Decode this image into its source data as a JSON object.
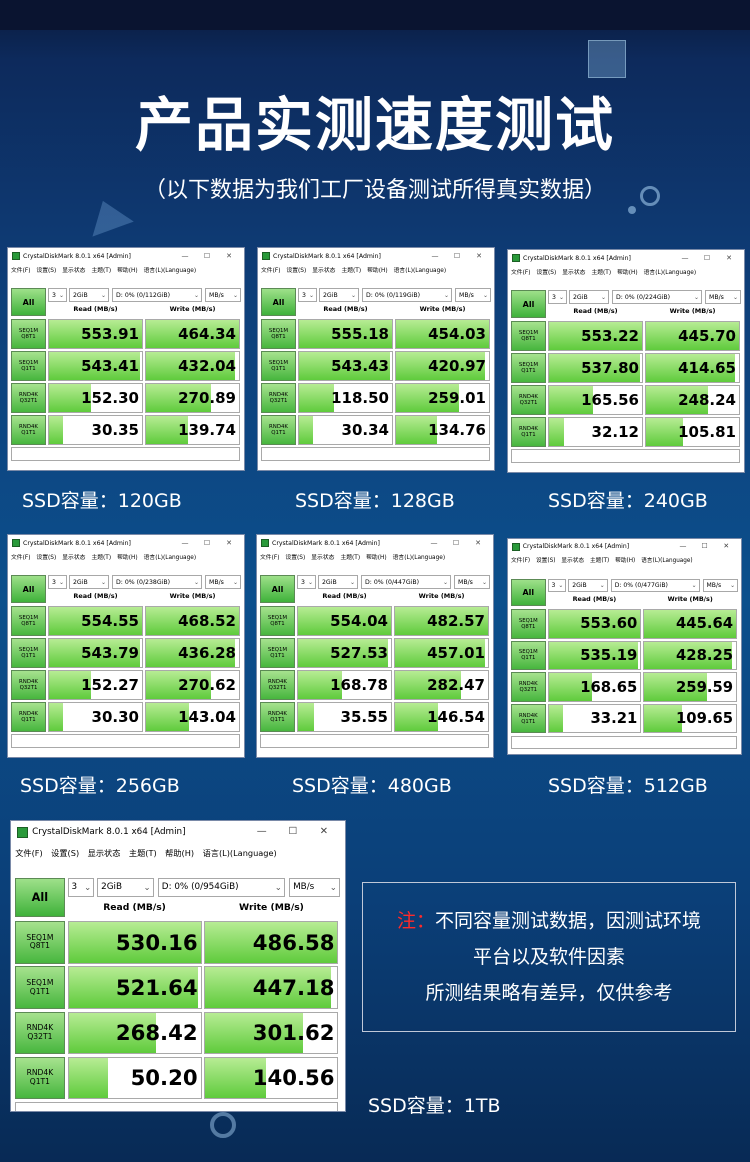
{
  "page": {
    "title": "产品实测速度测试",
    "subtitle": "（以下数据为我们工厂设备测试所得真实数据）",
    "note_prefix": "注：",
    "note_line1": "不同容量测试数据，因测试环境",
    "note_line2": "平台以及软件因素",
    "note_line3": "所测结果略有差异，仅供参考"
  },
  "ui": {
    "window_title": "CrystalDiskMark 8.0.1 x64 [Admin]",
    "minimize": "—",
    "maximize": "☐",
    "close": "✕",
    "menu": [
      "文件(F)",
      "设置(S)",
      "显示状态",
      "主题(T)",
      "帮助(H)",
      "语言(L)(Language)"
    ],
    "all_button": "All",
    "count": "3",
    "size": "2GiB",
    "unit": "MB/s",
    "read_header": "Read (MB/s)",
    "write_header": "Write (MB/s)",
    "tests": [
      {
        "line1": "SEQ1M",
        "line2": "Q8T1"
      },
      {
        "line1": "SEQ1M",
        "line2": "Q1T1"
      },
      {
        "line1": "RND4K",
        "line2": "Q32T1"
      },
      {
        "line1": "RND4K",
        "line2": "Q1T1"
      }
    ]
  },
  "panels": [
    {
      "drive": "D: 0% (0/112GiB)",
      "caption": "SSD容量：120GB",
      "read": [
        "553.91",
        "543.41",
        "152.30",
        "30.35"
      ],
      "write": [
        "464.34",
        "432.04",
        "270.89",
        "139.74"
      ],
      "read_fill": [
        1.0,
        0.98,
        0.45,
        0.15
      ],
      "write_fill": [
        1.0,
        0.96,
        0.7,
        0.45
      ]
    },
    {
      "drive": "D: 0% (0/119GiB)",
      "caption": "SSD容量：128GB",
      "read": [
        "555.18",
        "543.43",
        "118.50",
        "30.34"
      ],
      "write": [
        "454.03",
        "420.97",
        "259.01",
        "134.76"
      ],
      "read_fill": [
        1.0,
        0.98,
        0.38,
        0.15
      ],
      "write_fill": [
        1.0,
        0.96,
        0.68,
        0.44
      ]
    },
    {
      "drive": "D: 0% (0/224GiB)",
      "caption": "SSD容量：240GB",
      "read": [
        "553.22",
        "537.80",
        "165.56",
        "32.12"
      ],
      "write": [
        "445.70",
        "414.65",
        "248.24",
        "105.81"
      ],
      "read_fill": [
        1.0,
        0.98,
        0.47,
        0.16
      ],
      "write_fill": [
        1.0,
        0.96,
        0.67,
        0.4
      ]
    },
    {
      "drive": "D: 0% (0/238GiB)",
      "caption": "SSD容量：256GB",
      "read": [
        "554.55",
        "543.79",
        "152.27",
        "30.30"
      ],
      "write": [
        "468.52",
        "436.28",
        "270.62",
        "143.04"
      ],
      "read_fill": [
        1.0,
        0.98,
        0.45,
        0.15
      ],
      "write_fill": [
        1.0,
        0.96,
        0.7,
        0.46
      ]
    },
    {
      "drive": "D: 0% (0/447GiB)",
      "caption": "SSD容量：480GB",
      "read": [
        "554.04",
        "527.53",
        "168.78",
        "35.55"
      ],
      "write": [
        "482.57",
        "457.01",
        "282.47",
        "146.54"
      ],
      "read_fill": [
        1.0,
        0.97,
        0.47,
        0.17
      ],
      "write_fill": [
        1.0,
        0.97,
        0.71,
        0.46
      ]
    },
    {
      "drive": "D: 0% (0/477GiB)",
      "caption": "SSD容量：512GB",
      "read": [
        "553.60",
        "535.19",
        "168.65",
        "33.21"
      ],
      "write": [
        "445.64",
        "428.25",
        "259.59",
        "109.65"
      ],
      "read_fill": [
        1.0,
        0.97,
        0.47,
        0.16
      ],
      "write_fill": [
        1.0,
        0.96,
        0.68,
        0.41
      ]
    },
    {
      "drive": "D: 0% (0/954GiB)",
      "caption": "SSD容量：1TB",
      "read": [
        "530.16",
        "521.64",
        "268.42",
        "50.20"
      ],
      "write": [
        "486.58",
        "447.18",
        "301.62",
        "140.56"
      ],
      "read_fill": [
        1.0,
        0.98,
        0.66,
        0.3
      ],
      "write_fill": [
        1.0,
        0.95,
        0.74,
        0.46
      ]
    }
  ]
}
